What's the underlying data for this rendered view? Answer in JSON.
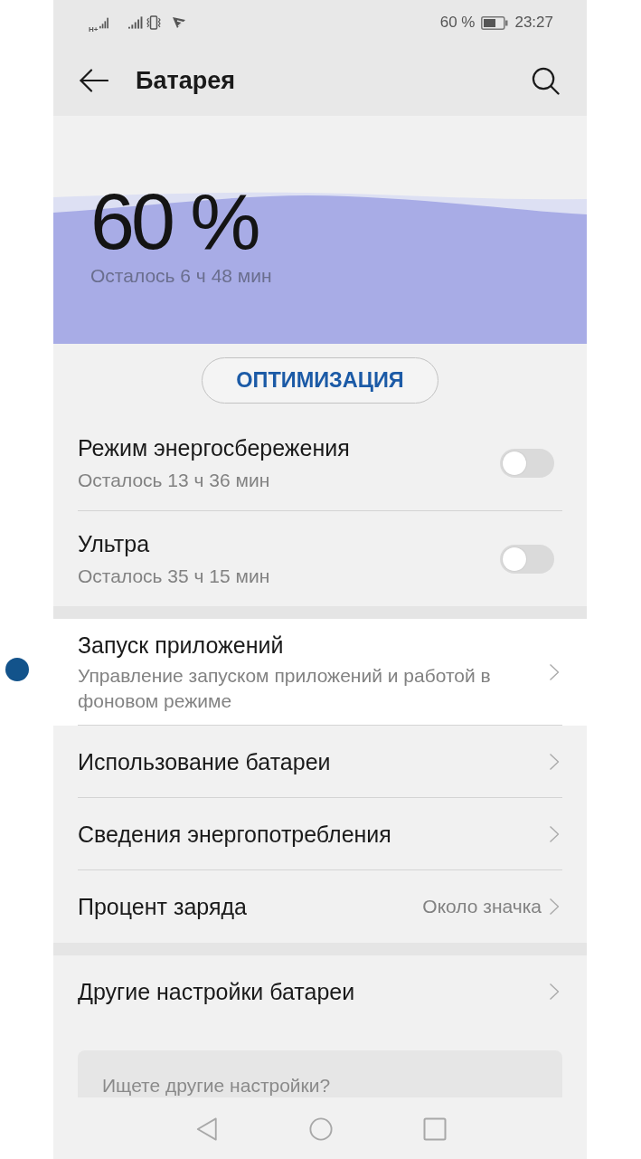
{
  "status_bar": {
    "network": "H+",
    "battery_percent": "60 %",
    "time": "23:27"
  },
  "header": {
    "title": "Батарея"
  },
  "battery": {
    "percent": "60 %",
    "remaining": "Осталось 6 ч 48 мин"
  },
  "optimize_button": {
    "label": "ОПТИМИЗАЦИЯ"
  },
  "power_modes": [
    {
      "title": "Режим энергосбережения",
      "subtitle": "Осталось 13 ч 36 мин",
      "on": false
    },
    {
      "title": "Ультра",
      "subtitle": "Осталось 35 ч 15 мин",
      "on": false
    }
  ],
  "sections": [
    {
      "items": [
        {
          "title": "Запуск приложений",
          "subtitle": "Управление запуском приложений и работой в фоновом режиме",
          "selected": true
        },
        {
          "title": "Использование батареи",
          "selected": false
        },
        {
          "title": "Сведения энергопотребления",
          "selected": false
        },
        {
          "title": "Процент заряда",
          "value": "Около значка",
          "selected": false
        }
      ]
    },
    {
      "items": [
        {
          "title": "Другие настройки батареи",
          "selected": false
        }
      ]
    }
  ],
  "suggestion_card": {
    "title": "Ищете другие настройки?"
  }
}
